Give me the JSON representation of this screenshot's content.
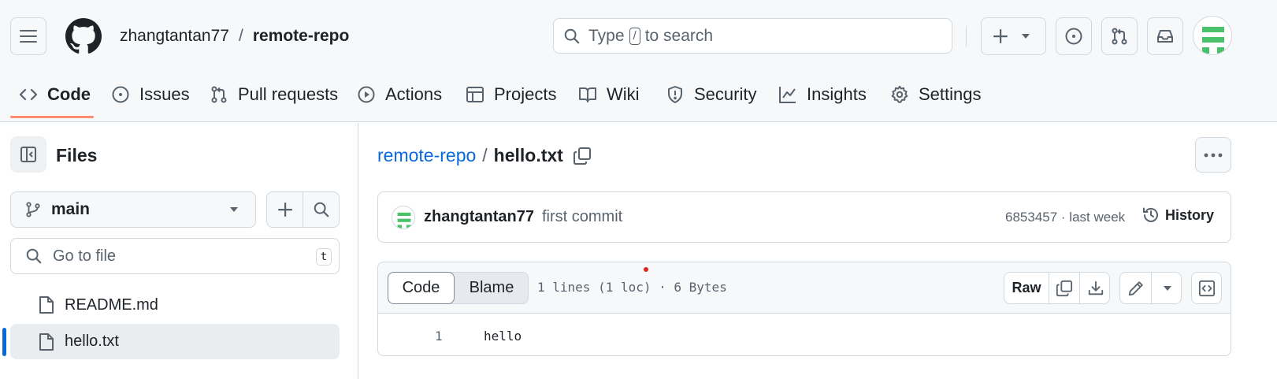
{
  "header": {
    "owner": "zhangtantan77",
    "separator": "/",
    "repo": "remote-repo",
    "search_prefix": "Type",
    "search_key": "/",
    "search_suffix": "to search"
  },
  "tabs": [
    {
      "label": "Code",
      "icon": "code-icon",
      "selected": true
    },
    {
      "label": "Issues",
      "icon": "issue-icon"
    },
    {
      "label": "Pull requests",
      "icon": "pull-request-icon"
    },
    {
      "label": "Actions",
      "icon": "play-icon"
    },
    {
      "label": "Projects",
      "icon": "table-icon"
    },
    {
      "label": "Wiki",
      "icon": "book-icon"
    },
    {
      "label": "Security",
      "icon": "shield-icon"
    },
    {
      "label": "Insights",
      "icon": "graph-icon"
    },
    {
      "label": "Settings",
      "icon": "gear-icon"
    }
  ],
  "sidebar": {
    "title": "Files",
    "branch": "main",
    "goto_placeholder": "Go to file",
    "goto_shortcut": "t",
    "files": [
      {
        "name": "README.md",
        "selected": false
      },
      {
        "name": "hello.txt",
        "selected": true
      }
    ]
  },
  "file": {
    "breadcrumb_repo": "remote-repo",
    "breadcrumb_sep": "/",
    "name": "hello.txt",
    "commit_author": "zhangtantan77",
    "commit_message": "first commit",
    "commit_meta": "6853457 · last week",
    "history_label": "History",
    "view_code": "Code",
    "view_blame": "Blame",
    "stats": "1 lines (1 loc) · 6 Bytes",
    "raw_label": "Raw",
    "lines": [
      {
        "number": "1",
        "text": "hello"
      }
    ]
  },
  "colors": {
    "accent_link": "#0969da",
    "tab_underline": "#fd8c73",
    "selected_file_bar": "#0969da",
    "avatar_green": "#4ac26b"
  }
}
